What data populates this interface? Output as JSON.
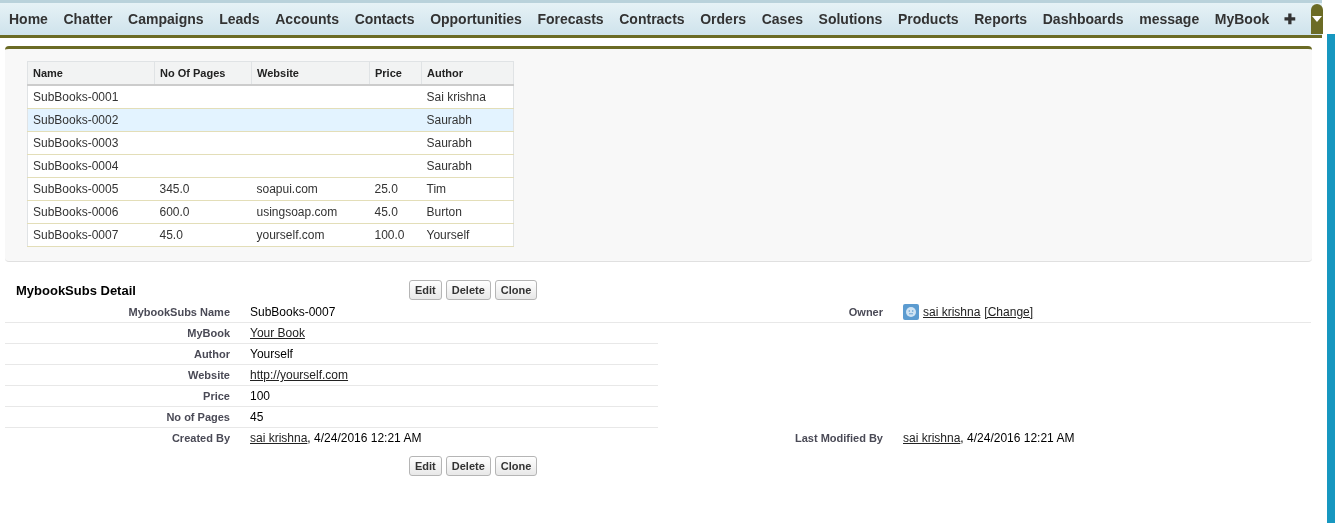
{
  "nav": {
    "tabs": [
      {
        "label": "Home",
        "selected": false
      },
      {
        "label": "Chatter",
        "selected": false
      },
      {
        "label": "Campaigns",
        "selected": false
      },
      {
        "label": "Leads",
        "selected": false
      },
      {
        "label": "Accounts",
        "selected": false
      },
      {
        "label": "Contacts",
        "selected": false
      },
      {
        "label": "Opportunities",
        "selected": false
      },
      {
        "label": "Forecasts",
        "selected": false
      },
      {
        "label": "Contracts",
        "selected": false
      },
      {
        "label": "Orders",
        "selected": false
      },
      {
        "label": "Cases",
        "selected": false
      },
      {
        "label": "Solutions",
        "selected": false
      },
      {
        "label": "Products",
        "selected": false
      },
      {
        "label": "Reports",
        "selected": false
      },
      {
        "label": "Dashboards",
        "selected": false
      },
      {
        "label": "message",
        "selected": false
      },
      {
        "label": "MyBook",
        "selected": false
      }
    ],
    "add_tab": "✚"
  },
  "table": {
    "columns": [
      "Name",
      "No Of Pages",
      "Website",
      "Price",
      "Author"
    ],
    "rows": [
      {
        "cells": [
          "SubBooks-0001",
          "",
          "",
          "",
          "Sai krishna"
        ],
        "selected": false
      },
      {
        "cells": [
          "SubBooks-0002",
          "",
          "",
          "",
          "Saurabh"
        ],
        "selected": true
      },
      {
        "cells": [
          "SubBooks-0003",
          "",
          "",
          "",
          "Saurabh"
        ],
        "selected": false
      },
      {
        "cells": [
          "SubBooks-0004",
          "",
          "",
          "",
          "Saurabh"
        ],
        "selected": false
      },
      {
        "cells": [
          "SubBooks-0005",
          "345.0",
          "soapui.com",
          "25.0",
          "Tim"
        ],
        "selected": false
      },
      {
        "cells": [
          "SubBooks-0006",
          "600.0",
          "usingsoap.com",
          "45.0",
          "Burton"
        ],
        "selected": false
      },
      {
        "cells": [
          "SubBooks-0007",
          "45.0",
          "yourself.com",
          "100.0",
          "Yourself"
        ],
        "selected": false
      }
    ]
  },
  "detail": {
    "title": "MybookSubs Detail",
    "buttons": [
      "Edit",
      "Delete",
      "Clone"
    ],
    "rows": [
      {
        "left": {
          "label": "MybookSubs Name",
          "value": [
            {
              "kind": "text",
              "text": "SubBooks-0007"
            }
          ]
        },
        "right": {
          "label": "Owner",
          "value": [
            {
              "kind": "avatar"
            },
            {
              "kind": "link",
              "text": "sai krishna"
            },
            {
              "kind": "link",
              "text": "[Change]"
            }
          ]
        }
      },
      {
        "left": {
          "label": "MyBook",
          "value": [
            {
              "kind": "link",
              "text": "Your Book"
            }
          ]
        }
      },
      {
        "left": {
          "label": "Author",
          "value": [
            {
              "kind": "text",
              "text": "Yourself"
            }
          ]
        }
      },
      {
        "left": {
          "label": "Website",
          "value": [
            {
              "kind": "link",
              "text": "http://yourself.com"
            }
          ]
        }
      },
      {
        "left": {
          "label": "Price",
          "value": [
            {
              "kind": "text",
              "text": "100"
            }
          ]
        }
      },
      {
        "left": {
          "label": "No of Pages",
          "value": [
            {
              "kind": "text",
              "text": "45"
            }
          ]
        }
      },
      {
        "left": {
          "label": "Created By",
          "value": [
            {
              "kind": "link",
              "text": "sai krishna"
            },
            {
              "kind": "text",
              "text": ", 4/24/2016 12:21 AM"
            }
          ]
        },
        "right": {
          "label": "Last Modified By",
          "value": [
            {
              "kind": "link",
              "text": "sai krishna"
            },
            {
              "kind": "text",
              "text": ", 4/24/2016 12:21 AM"
            }
          ]
        }
      }
    ],
    "bottom_buttons": [
      "Edit",
      "Delete",
      "Clone"
    ]
  }
}
